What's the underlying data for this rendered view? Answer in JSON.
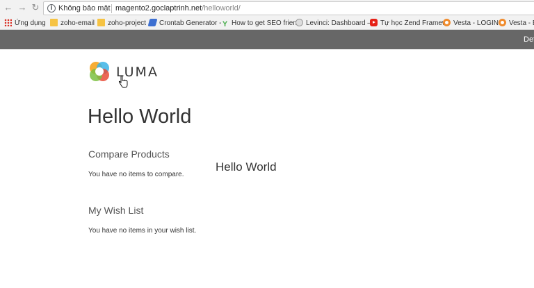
{
  "browser": {
    "security_label": "Không bảo mật",
    "url_host": "magento2.goclaptrinh.net",
    "url_path": "/helloworld/"
  },
  "bookmarks": [
    {
      "label": "Ứng dụng",
      "icon": "apps-grid-icon"
    },
    {
      "label": "zoho-email",
      "icon": "folder-icon"
    },
    {
      "label": "zoho-project",
      "icon": "folder-icon"
    },
    {
      "label": "Crontab Generator -",
      "icon": "crontab-icon"
    },
    {
      "label": "How to get SEO frien",
      "icon": "seo-icon"
    },
    {
      "label": "Levinci: Dashboard –",
      "icon": "levinci-icon"
    },
    {
      "label": "Tự học Zend Framew",
      "icon": "youtube-icon"
    },
    {
      "label": "Vesta - LOGIN",
      "icon": "vesta-icon"
    },
    {
      "label": "Vesta - B",
      "icon": "vesta-icon"
    }
  ],
  "header": {
    "strip_link": "Def"
  },
  "logo": {
    "text": "LUMA"
  },
  "main": {
    "title": "Hello World",
    "compare": {
      "title": "Compare Products",
      "empty_text": "You have no items to compare."
    },
    "wishlist": {
      "title": "My Wish List",
      "empty_text": "You have no items in your wish list."
    },
    "inline_text": "Hello World"
  }
}
